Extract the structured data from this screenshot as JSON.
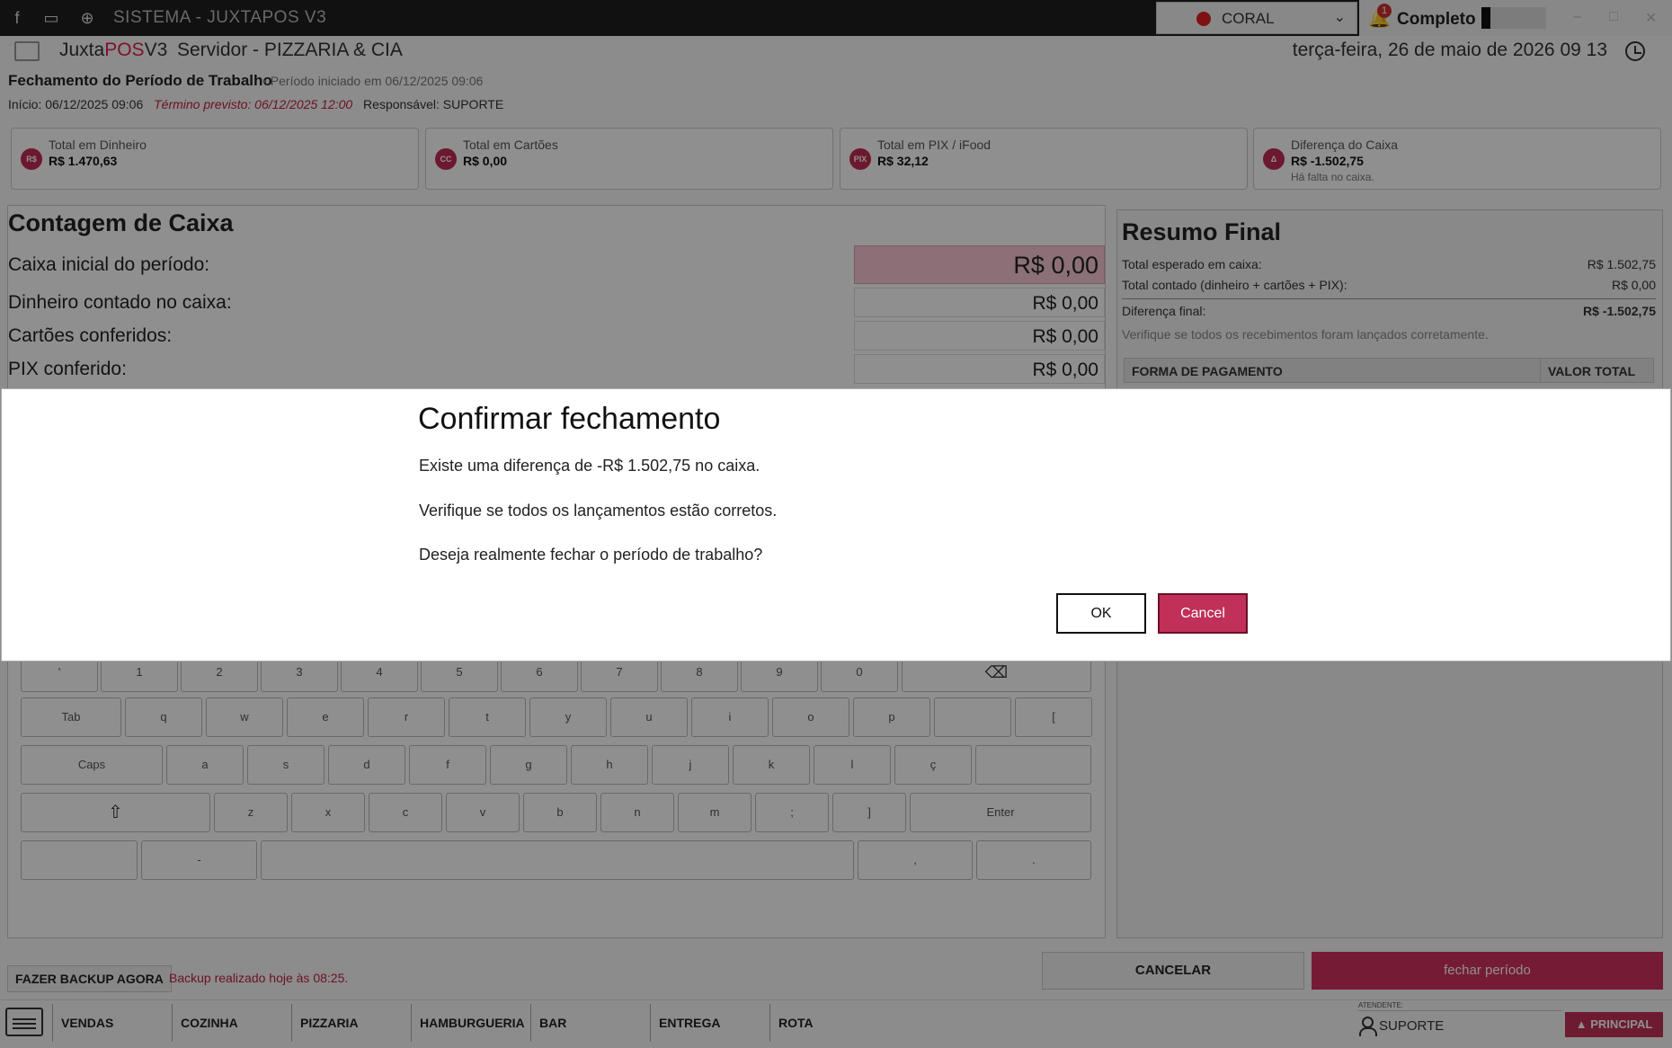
{
  "titlebar": {
    "title": "SISTEMA - JUXTAPOS V3",
    "station_select": "CORAL",
    "notification_count": "1",
    "status_label": "Completo"
  },
  "header": {
    "brand_prefix": "Juxta",
    "brand_highlight": "POS",
    "brand_suffix": "V3",
    "server": "Servidor - PIZZARIA & CIA",
    "datetime": "terça-feira, 26 de maio de 2026 09 13"
  },
  "period": {
    "title": "Fechamento do Período de Trabalho",
    "subtitle": "• Período iniciado em 06/12/2025 09:06",
    "start": "Início: 06/12/2025 09:06",
    "expected_end": "Término previsto: 06/12/2025 12:00",
    "responsible": "Responsável: SUPORTE"
  },
  "kpis": [
    {
      "icon": "R$",
      "label": "Total em Dinheiro",
      "value": "R$ 1.470,63",
      "note": ""
    },
    {
      "icon": "CC",
      "label": "Total em Cartões",
      "value": "R$ 0,00",
      "note": ""
    },
    {
      "icon": "PIX",
      "label": "Total em PIX / iFood",
      "value": "R$ 32,12",
      "note": ""
    },
    {
      "icon": "Δ",
      "label": "Diferença do Caixa",
      "value": "R$ -1.502,75",
      "note": "Há falta no caixa."
    }
  ],
  "contagem": {
    "title": "Contagem de Caixa",
    "rows": [
      {
        "label": "Caixa inicial do período:",
        "value": "R$ 0,00"
      },
      {
        "label": "Dinheiro contado no caixa:",
        "value": "R$ 0,00"
      },
      {
        "label": "Cartões conferidos:",
        "value": "R$ 0,00"
      },
      {
        "label": "PIX conferido:",
        "value": "R$ 0,00"
      }
    ]
  },
  "resumo": {
    "title": "Resumo Final",
    "expected_label": "Total esperado em caixa:",
    "expected_value": "R$ 1.502,75",
    "counted_label": "Total contado (dinheiro + cartões + PIX):",
    "counted_value": "R$ 0,00",
    "diff_label": "Diferença final:",
    "diff_value": "R$ -1.502,75",
    "hint": "Verifique se todos os recebimentos foram lançados corretamente.",
    "col_payment": "FORMA DE PAGAMENTO",
    "col_total": "VALOR TOTAL"
  },
  "keyboard": {
    "row1": [
      "'",
      "1",
      "2",
      "3",
      "4",
      "5",
      "6",
      "7",
      "8",
      "9",
      "0"
    ],
    "row2": [
      "Tab",
      "q",
      "w",
      "e",
      "r",
      "t",
      "y",
      "u",
      "i",
      "o",
      "p",
      "",
      "["
    ],
    "row3": [
      "Caps",
      "a",
      "s",
      "d",
      "f",
      "g",
      "h",
      "j",
      "k",
      "l",
      "ç",
      ""
    ],
    "row4": [
      "z",
      "x",
      "c",
      "v",
      "b",
      "n",
      "m",
      ";",
      "]",
      "Enter"
    ],
    "row5": [
      "",
      "-",
      "",
      ",",
      "."
    ]
  },
  "footer": {
    "backup_button": "FAZER BACKUP AGORA",
    "backup_status": "Backup realizado hoje às 08:25.",
    "cancel_button": "CANCELAR",
    "close_button": "fechar período"
  },
  "bottom_nav": {
    "items": [
      "VENDAS",
      "COZINHA",
      "PIZZARIA",
      "HAMBURGUERIA",
      "BAR",
      "ENTREGA",
      "ROTA"
    ],
    "attendant_label": "ATENDENTE:",
    "attendant_name": "SUPORTE",
    "principal_button": "PRINCIPAL"
  },
  "dialog": {
    "title": "Confirmar fechamento",
    "line1": "Existe uma diferença de -R$ 1.502,75 no caixa.",
    "line2": "Verifique se todos os lançamentos estão corretos.",
    "line3": "Deseja realmente fechar o período de trabalho?",
    "ok": "OK",
    "cancel": "Cancel"
  },
  "colors": {
    "accent": "#c03058",
    "highlight_input": "#f8c8d4",
    "warning_text": "#c02040"
  }
}
